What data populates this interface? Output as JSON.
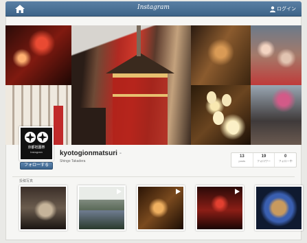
{
  "header": {
    "brand": "Instagram",
    "login_label": "ログイン"
  },
  "profile": {
    "avatar_line1": "京都祇園祭",
    "avatar_line2": "Instagram",
    "follow_label": "フォローする",
    "username": "kyotogionmatsuri",
    "username_suffix": "-",
    "full_name": "Shingo Takadera",
    "stats": [
      {
        "value": "13",
        "label": "posts"
      },
      {
        "value": "19",
        "label": "フォロワー"
      },
      {
        "value": "0",
        "label": "フォロー中"
      }
    ]
  },
  "photos_section": {
    "title": "投稿写真"
  },
  "colors": {
    "topbar": "#3e6488",
    "follow_button": "#3a628a",
    "background": "#e9e9e6"
  },
  "icons": {
    "home": "home-icon",
    "user": "user-icon",
    "video": "play-icon"
  }
}
